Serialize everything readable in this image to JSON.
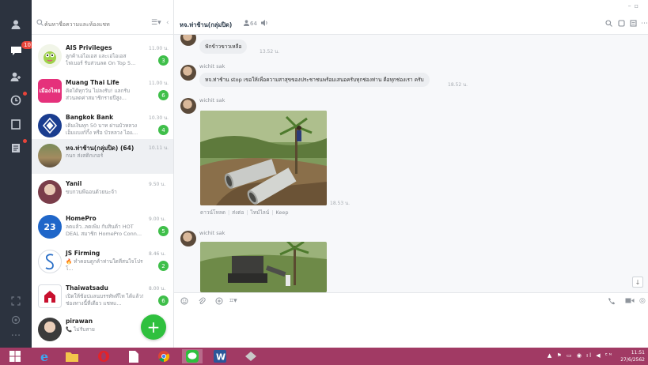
{
  "sidebar": {
    "notification_badge": "10"
  },
  "search": {
    "placeholder": "ค้นหาชื่อความและห้องแชท"
  },
  "chats": [
    {
      "name": "AIS Privileges",
      "preview": "ลูกค้าเอไอเอส และเอไอเอส ไฟเบอร์ รับส่วนลด On Top 5...",
      "time": "11.00 น.",
      "unread": "3"
    },
    {
      "name": "Muang Thai Life",
      "preview": "คิดได้ทุกวัน ไม่ลงรับ! แลกรับส่วนลดค่าสมาชิกรายปีสูง...",
      "time": "11.00 น.",
      "unread": "6"
    },
    {
      "name": "Bangkok Bank",
      "preview": "เติมเงินทุก 50 บาท ผ่านบัวหลวง เอ็มแบงก์กิ้ง หรือ บัวหลวง ไอแ...",
      "time": "10.30 น.",
      "unread": "4"
    },
    {
      "name": "หจ.ท่าช้าน(กลุ่มปิด) (64)",
      "preview": "กนก ส่งสติกเกอร์",
      "time": "10.11 น.",
      "unread": ""
    },
    {
      "name": "Yanil",
      "preview": "ขบกวนพี่ฉอนด้วยนะจ้า",
      "time": "9.50 น.",
      "unread": ""
    },
    {
      "name": "HomePro",
      "preview": "ลดแล้ว..ลดเพิ่ม กับสินค้า HOT DEAL สมาชิก HomePro Conn...",
      "time": "9.00 น.",
      "unread": "5"
    },
    {
      "name": "JS Firming",
      "preview": "🔥 ทำคอนดูกค้าท่านใดที่สนใจโปรโ...",
      "time": "8.46 น.",
      "unread": "2"
    },
    {
      "name": "Thaiwatsadu",
      "preview": "เปิดให้ช้อปแลนบรรทัพที่ไท ได้แล้ว! ช่องทางนี้ที่เดียว แชทแ...",
      "time": "8.00 น.",
      "unread": "6"
    },
    {
      "name": "pirawan",
      "preview": "📞 ไม่รับสาย",
      "time": "",
      "unread": ""
    }
  ],
  "chat": {
    "title": "หจ.ท่าช้าน(กลุ่มปิด)",
    "member_count": "64",
    "messages": [
      {
        "sender": "",
        "text": "ฟักข้าวขาวเหลือ",
        "time": "13.52 น."
      },
      {
        "sender": "wichit sak",
        "text": "หจ.ท่าช้าน stop เขอให้เพื่อความสาสุขของประชาชนพร้อมเสนอครับทุกช่องท่าน คือทุกช่องเรา ครับ",
        "time": "18.52 น."
      },
      {
        "sender": "wichit sak",
        "text": "",
        "time": "18.53 น."
      },
      {
        "sender": "wichit sak",
        "text": "",
        "time": ""
      }
    ],
    "photo_actions": [
      "ดาวน์โหลด",
      "ส่งต่อ",
      "ไทม์ไลน์",
      "Keep"
    ]
  },
  "taskbar": {
    "time": "11:51",
    "date": "27/6/2562"
  }
}
